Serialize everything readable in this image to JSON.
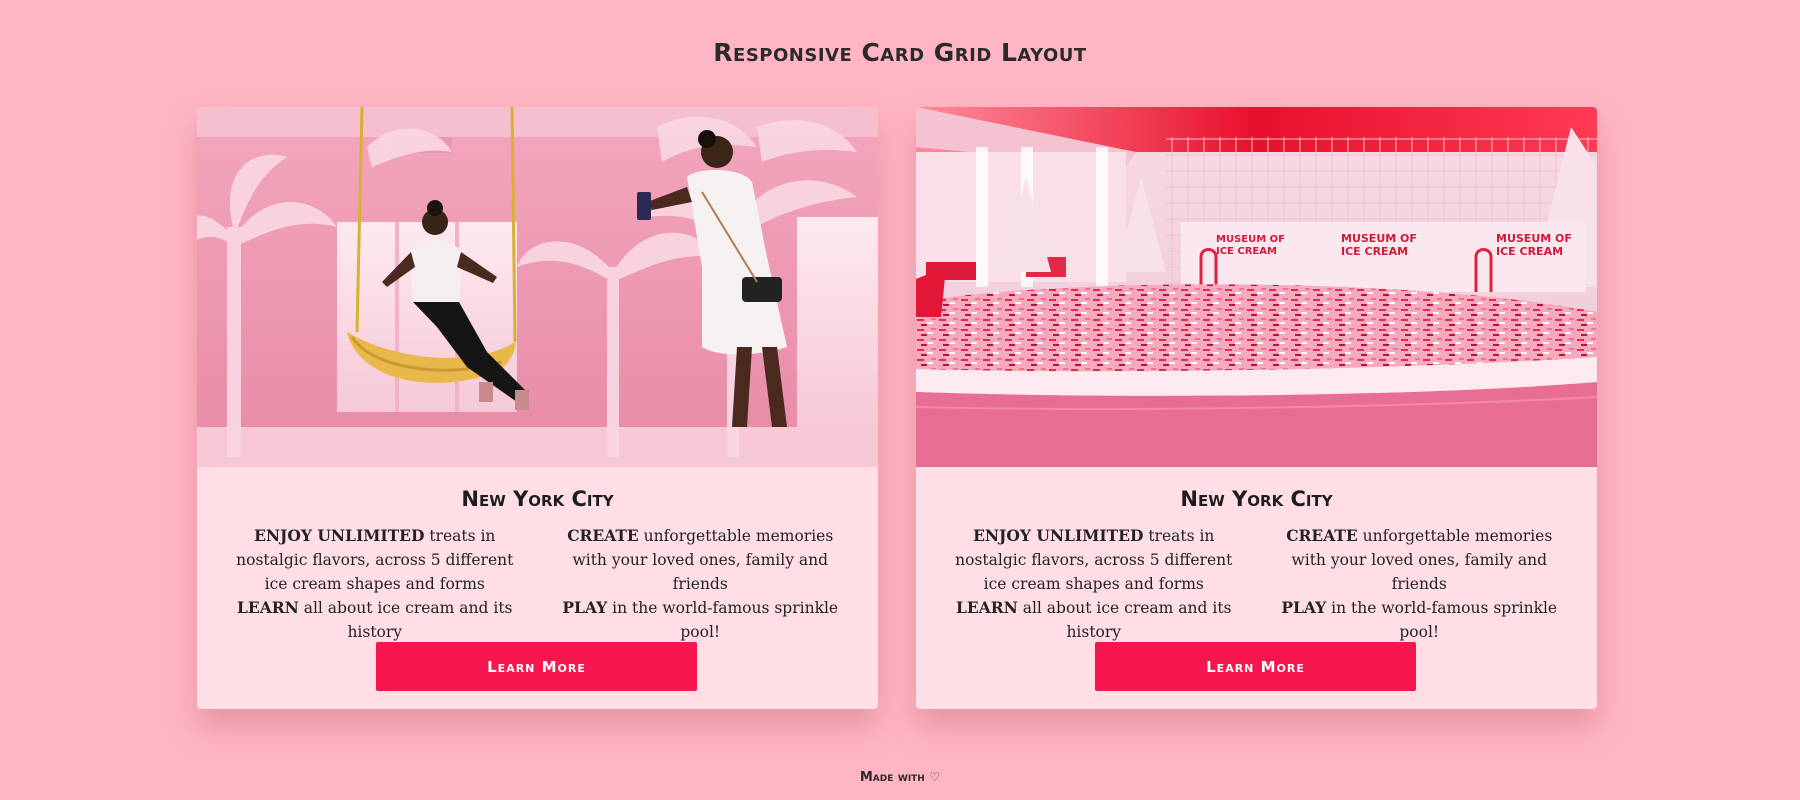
{
  "page": {
    "title": "Responsive Card Grid Layout"
  },
  "cards": [
    {
      "image_alt": "Woman on a banana swing in a pink room while another woman photographs her",
      "title": "New York City",
      "features": [
        {
          "bold": "ENJOY UNLIMITED",
          "text": " treats in nostalgic flavors, across 5 different ice cream shapes and forms"
        },
        {
          "bold": "CREATE",
          "text": " unforgettable memories with your loved ones, family and friends"
        },
        {
          "bold": "LEARN",
          "text": " all about ice cream and its history"
        },
        {
          "bold": "PLAY",
          "text": " in the world-famous sprinkle pool!"
        }
      ],
      "button_label": "Learn More"
    },
    {
      "image_alt": "Sprinkle pool at the Museum of Ice Cream with pink christmas trees",
      "title": "New York City",
      "sign_text": "MUSEUM OF ICE CREAM",
      "features": [
        {
          "bold": "ENJOY UNLIMITED",
          "text": " treats in nostalgic flavors, across 5 different ice cream shapes and forms"
        },
        {
          "bold": "CREATE",
          "text": " unforgettable memories with your loved ones, family and friends"
        },
        {
          "bold": "LEARN",
          "text": " all about ice cream and its history"
        },
        {
          "bold": "PLAY",
          "text": " in the world-famous sprinkle pool!"
        }
      ],
      "button_label": "Learn More"
    }
  ],
  "footer": {
    "label": "Made with",
    "heart": "♡"
  },
  "colors": {
    "background": "#ffb5c3",
    "card": "#ffdfe5",
    "button": "#f7174e"
  }
}
